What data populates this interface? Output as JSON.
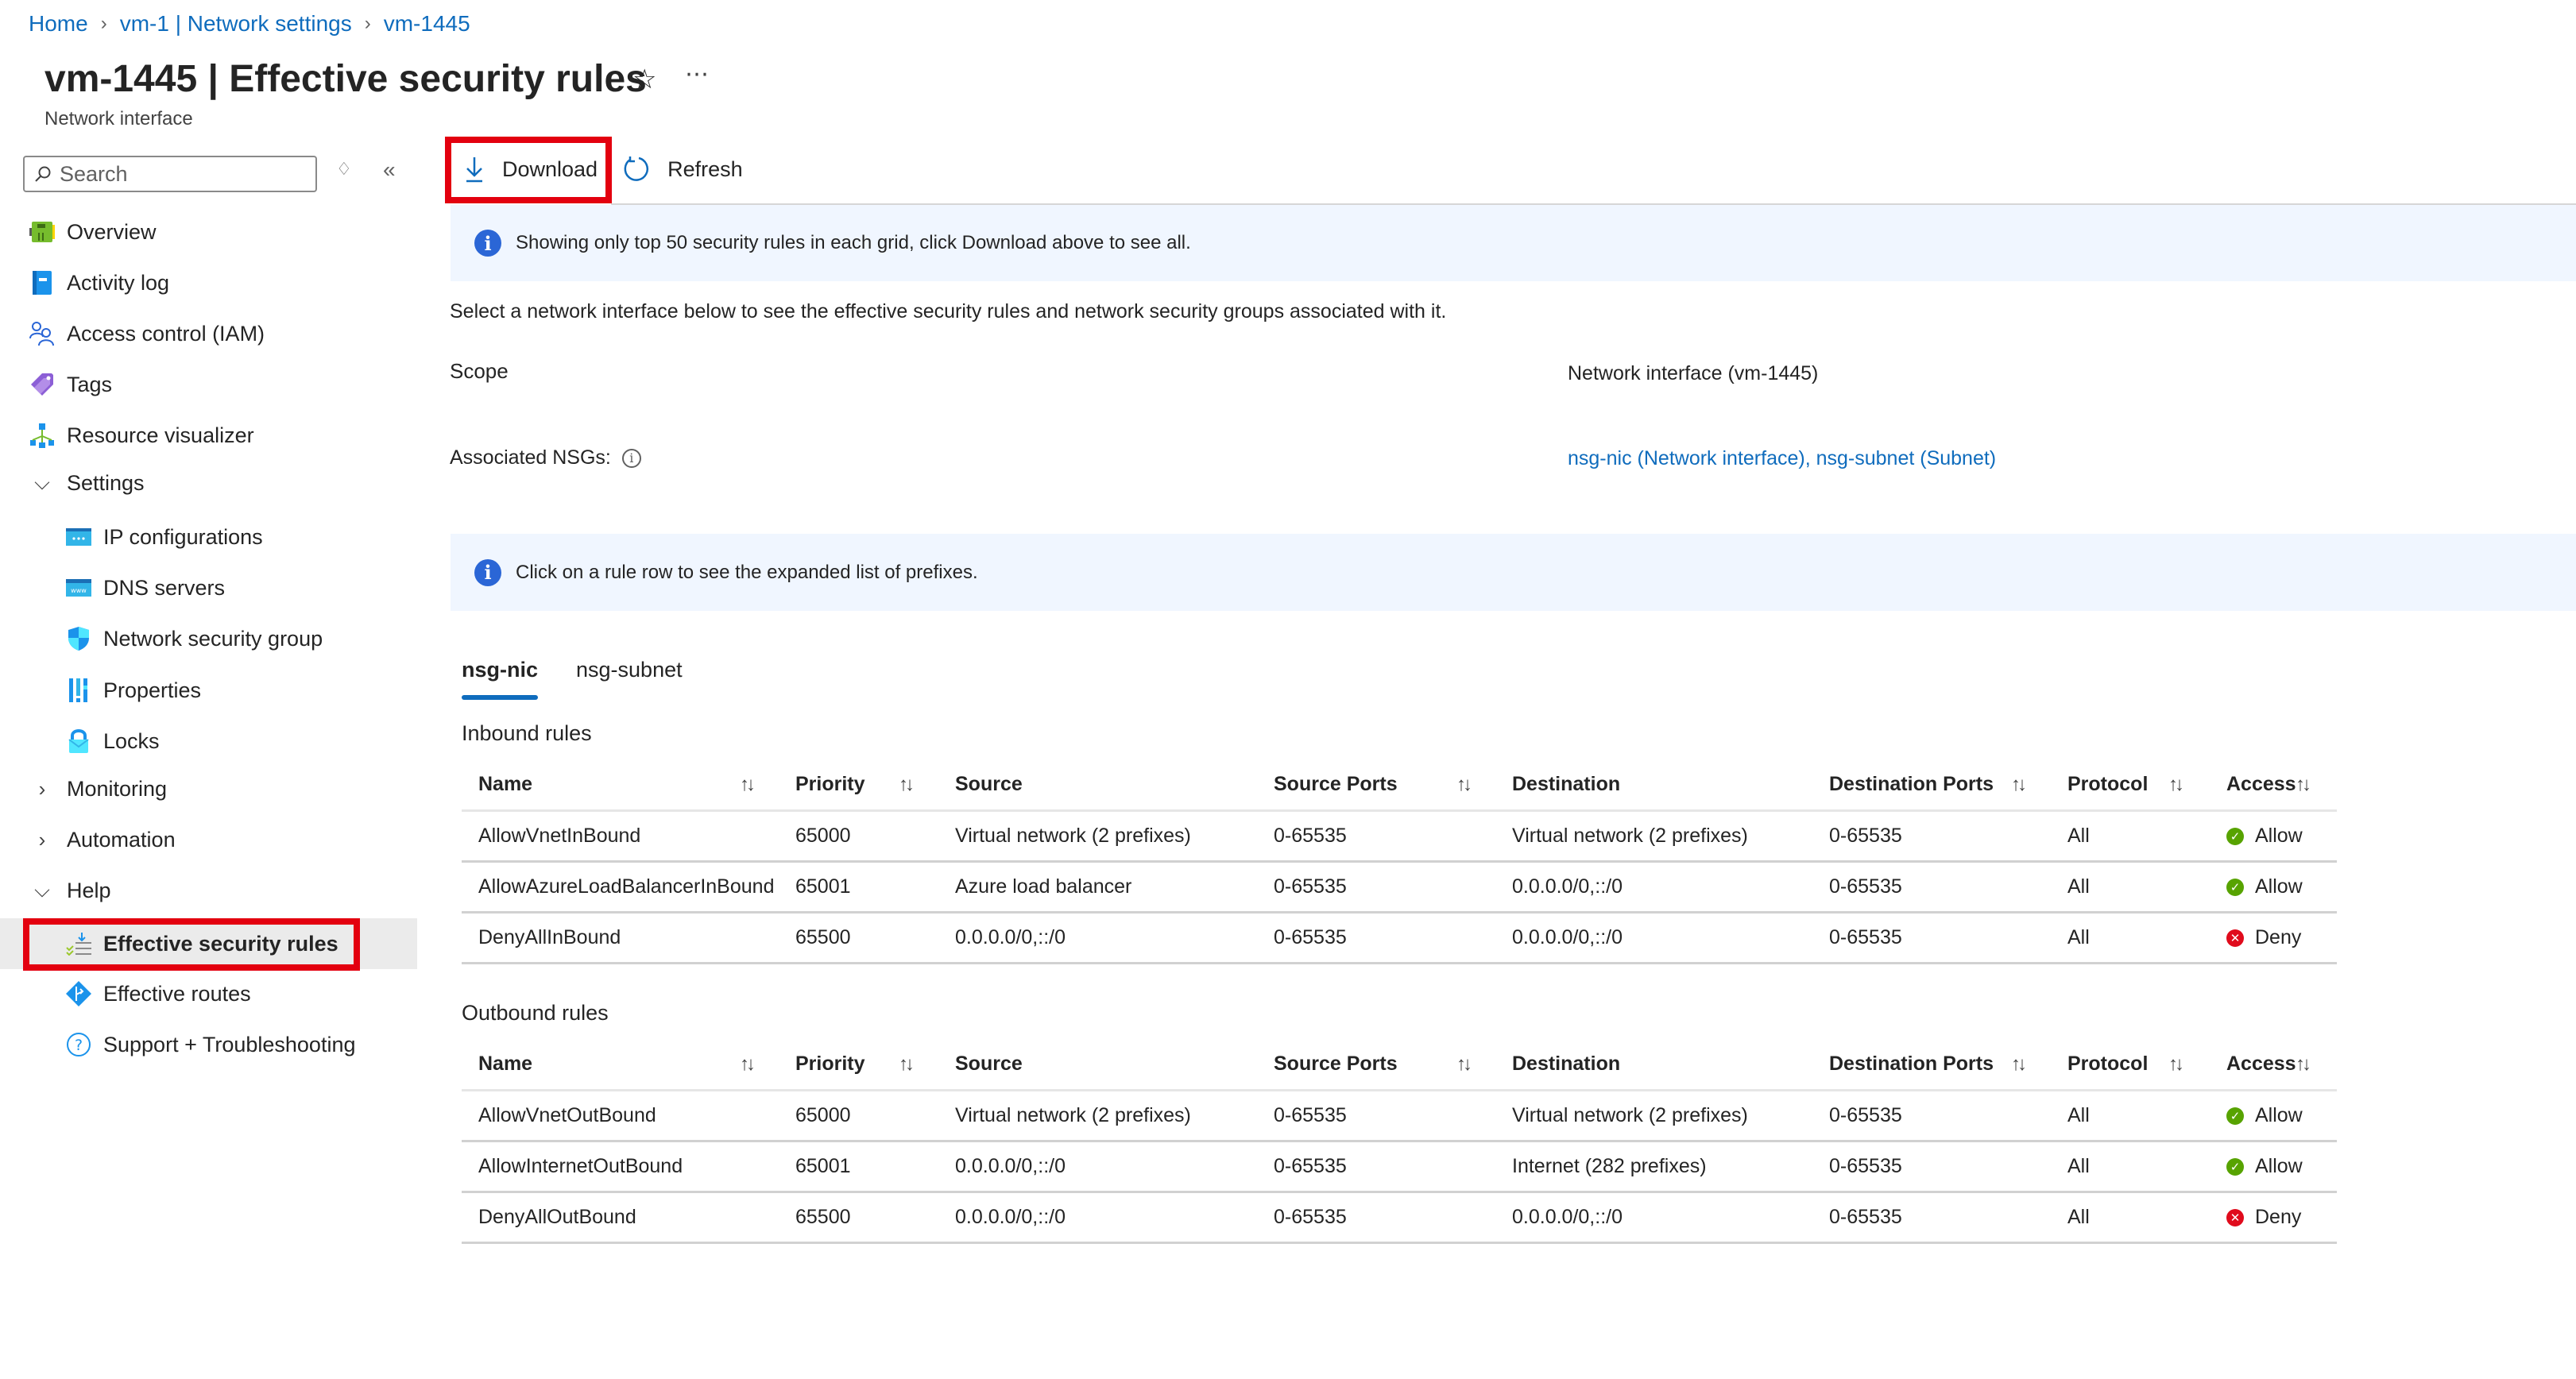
{
  "breadcrumb": [
    {
      "label": "Home"
    },
    {
      "label": "vm-1 | Network settings"
    },
    {
      "label": "vm-1445"
    }
  ],
  "breadcrumb_separator": ">",
  "header": {
    "resource_name": "vm-1445",
    "title_separator": " | ",
    "page_name": "Effective security rules",
    "subtitle": "Network interface",
    "favorite_icon": "star-icon",
    "more_icon": "ellipsis-icon"
  },
  "sidebar": {
    "search_placeholder": "Search",
    "search_value": "",
    "items": [
      {
        "label": "Overview",
        "icon": "network-interface-icon",
        "level": 0
      },
      {
        "label": "Activity log",
        "icon": "activity-log-icon",
        "level": 0
      },
      {
        "label": "Access control (IAM)",
        "icon": "people-icon",
        "level": 0
      },
      {
        "label": "Tags",
        "icon": "tag-icon",
        "level": 0
      },
      {
        "label": "Resource visualizer",
        "icon": "hierarchy-icon",
        "level": 0
      },
      {
        "label": "Settings",
        "icon": "chevron-down-icon",
        "level": 0,
        "group": true,
        "expanded": true
      },
      {
        "label": "IP configurations",
        "icon": "ip-config-icon",
        "level": 1
      },
      {
        "label": "DNS servers",
        "icon": "dns-icon",
        "level": 1
      },
      {
        "label": "Network security group",
        "icon": "shield-icon",
        "level": 1
      },
      {
        "label": "Properties",
        "icon": "properties-icon",
        "level": 1
      },
      {
        "label": "Locks",
        "icon": "lock-icon",
        "level": 1
      },
      {
        "label": "Monitoring",
        "icon": "chevron-right-icon",
        "level": 0,
        "group": true,
        "expanded": false
      },
      {
        "label": "Automation",
        "icon": "chevron-right-icon",
        "level": 0,
        "group": true,
        "expanded": false
      },
      {
        "label": "Help",
        "icon": "chevron-down-icon",
        "level": 0,
        "group": true,
        "expanded": true
      },
      {
        "label": "Effective security rules",
        "icon": "security-rules-icon",
        "level": 1,
        "selected": true
      },
      {
        "label": "Effective routes",
        "icon": "routes-icon",
        "level": 1
      },
      {
        "label": "Support + Troubleshooting",
        "icon": "question-icon",
        "level": 1
      }
    ]
  },
  "toolbar": {
    "download_label": "Download",
    "refresh_label": "Refresh"
  },
  "banners": {
    "top": "Showing only top 50 security rules in each grid, click Download above to see all.",
    "prefix": "Click on a rule row to see the expanded list of prefixes."
  },
  "details": {
    "intro": "Select a network interface below to see the effective security rules and network security groups associated with it.",
    "scope_label": "Scope",
    "scope_value": "Network interface (vm-1445)",
    "nsgs_label": "Associated NSGs:",
    "nsgs_value": "nsg-nic (Network interface), nsg-subnet (Subnet)"
  },
  "tabs": [
    {
      "label": "nsg-nic",
      "active": true
    },
    {
      "label": "nsg-subnet",
      "active": false
    }
  ],
  "columns": {
    "name": "Name",
    "priority": "Priority",
    "source": "Source",
    "source_ports": "Source Ports",
    "destination": "Destination",
    "destination_ports": "Destination Ports",
    "protocol": "Protocol",
    "access": "Access",
    "sort_glyph": "↑↓"
  },
  "inbound": {
    "title": "Inbound rules",
    "rows": [
      {
        "name": "AllowVnetInBound",
        "priority": "65000",
        "source": "Virtual network (2 prefixes)",
        "source_ports": "0-65535",
        "destination": "Virtual network (2 prefixes)",
        "destination_ports": "0-65535",
        "protocol": "All",
        "access": "Allow"
      },
      {
        "name": "AllowAzureLoadBalancerInBound",
        "priority": "65001",
        "source": "Azure load balancer",
        "source_ports": "0-65535",
        "destination": "0.0.0.0/0,::/0",
        "destination_ports": "0-65535",
        "protocol": "All",
        "access": "Allow"
      },
      {
        "name": "DenyAllInBound",
        "priority": "65500",
        "source": "0.0.0.0/0,::/0",
        "source_ports": "0-65535",
        "destination": "0.0.0.0/0,::/0",
        "destination_ports": "0-65535",
        "protocol": "All",
        "access": "Deny"
      }
    ]
  },
  "outbound": {
    "title": "Outbound rules",
    "rows": [
      {
        "name": "AllowVnetOutBound",
        "priority": "65000",
        "source": "Virtual network (2 prefixes)",
        "source_ports": "0-65535",
        "destination": "Virtual network (2 prefixes)",
        "destination_ports": "0-65535",
        "protocol": "All",
        "access": "Allow"
      },
      {
        "name": "AllowInternetOutBound",
        "priority": "65001",
        "source": "0.0.0.0/0,::/0",
        "source_ports": "0-65535",
        "destination": "Internet (282 prefixes)",
        "destination_ports": "0-65535",
        "protocol": "All",
        "access": "Allow"
      },
      {
        "name": "DenyAllOutBound",
        "priority": "65500",
        "source": "0.0.0.0/0,::/0",
        "source_ports": "0-65535",
        "destination": "0.0.0.0/0,::/0",
        "destination_ports": "0-65535",
        "protocol": "All",
        "access": "Deny"
      }
    ]
  },
  "colors": {
    "link": "#0f6cbd",
    "highlight_outline": "#e3000f",
    "banner_bg": "#f0f6ff",
    "info_icon": "#2b66d6",
    "allow": "#57a300",
    "deny": "#e00b1c",
    "selected_bg": "#ebebeb"
  }
}
